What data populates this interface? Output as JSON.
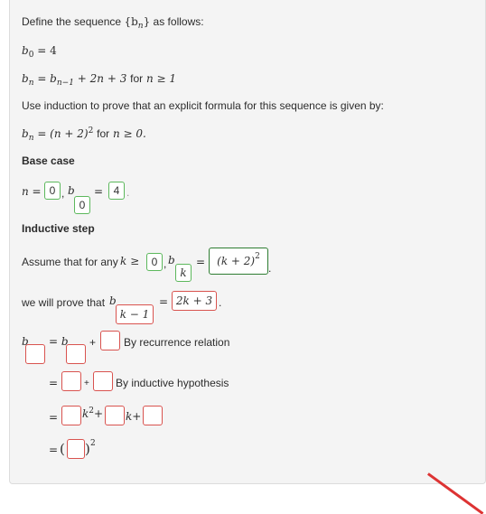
{
  "intro": {
    "define": "Define the sequence",
    "seq": "{b",
    "seq_sub": "n",
    "seq_close": "}",
    "as_follows": "as follows:"
  },
  "def": {
    "b0_b": "b",
    "b0_sub": "0",
    "b0_rest": "= 4",
    "rec_lhs": "b",
    "rec_lhs_sub": "n",
    "rec_eq": "= b",
    "rec_eq_sub": "n−1",
    "rec_tail": "+ 2n + 3",
    "rec_for": "for",
    "rec_cond": "n ≥ 1"
  },
  "prompt": {
    "text": "Use induction to prove that an explicit formula for this sequence is given by:",
    "formula_b": "b",
    "formula_sub": "n",
    "formula_rhs": "= (n + 2)",
    "formula_sup": "2",
    "formula_for": "for",
    "formula_cond": "n ≥ 0."
  },
  "base_case": {
    "heading": "Base case",
    "n_label": "n =",
    "n_value": "0",
    "b_label": "b",
    "b_sub_value": "0",
    "eq": "=",
    "value": "4",
    "comma": ","
  },
  "inductive": {
    "heading": "Inductive step",
    "assume": "Assume that for any",
    "k_geq": "k ≥",
    "k_value": "0",
    "b_label": "b",
    "b_sub_value": "k",
    "eq": "=",
    "hyp_value": "(k + 2)",
    "hyp_sup": "2",
    "period": ".",
    "prove": "we will prove that",
    "prove_b": "b",
    "prove_sub_value": "k − 1",
    "prove_eq": "=",
    "prove_value": "2k + 3",
    "prove_period": "."
  },
  "steps": {
    "b": "b",
    "eq_b": "= b",
    "plus": "+",
    "by_recurrence": "By recurrence relation",
    "eq": "=",
    "plus_small": "+",
    "by_hypothesis": "By inductive hypothesis",
    "k2_plus": "k",
    "k2_sup": "2",
    "k2_plus_sign": "+",
    "k_plus": "k+",
    "open_paren": "(",
    "close_paren": ")",
    "final_sup": "2"
  },
  "colors": {
    "correct": "#5cb85c",
    "incorrect": "#d9534f",
    "annotation": "#dd3333"
  }
}
